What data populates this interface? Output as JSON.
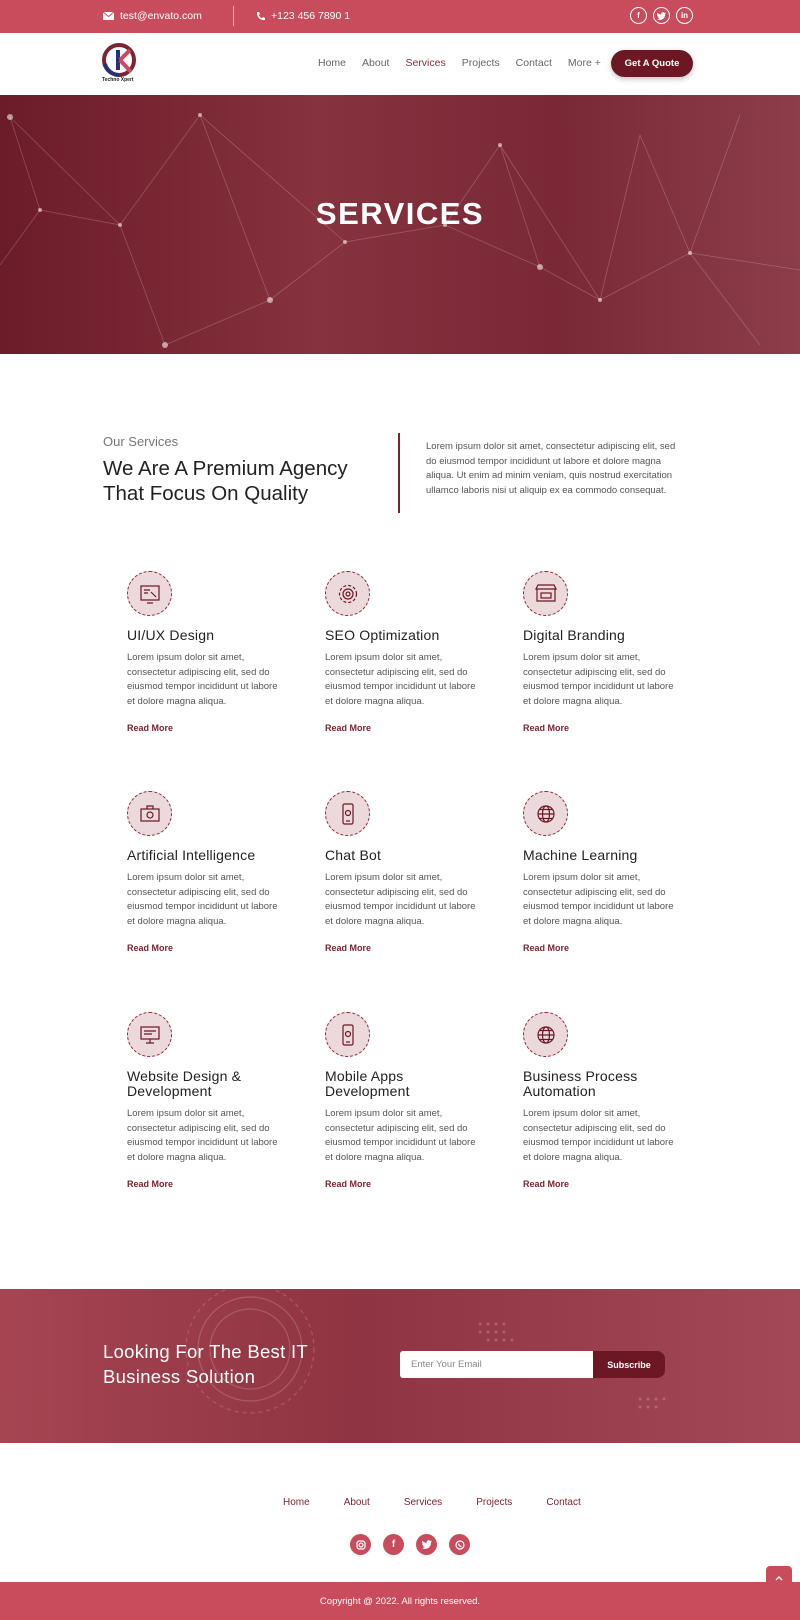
{
  "topbar": {
    "email": "test@envato.com",
    "phone": "+123 456 7890 1",
    "socials": [
      "facebook-icon",
      "twitter-icon",
      "linkedin-icon"
    ]
  },
  "nav": {
    "logo_text": "Techno Xpert",
    "items": [
      "Home",
      "About",
      "Services",
      "Projects",
      "Contact",
      "More +"
    ],
    "active": "Services",
    "quote_button": "Get A Quote"
  },
  "hero": {
    "title": "SERVICES"
  },
  "intro": {
    "subtitle": "Our Services",
    "title": "We Are A Premium Agency That Focus On Quality",
    "text": "Lorem ipsum dolor sit amet, consectetur adipiscing elit, sed do eiusmod tempor incididunt ut labore et dolore magna aliqua. Ut enim ad minim veniam, quis nostrud exercitation ullamco laboris nisi ut aliquip ex ea commodo consequat."
  },
  "services": [
    {
      "title": "UI/UX Design",
      "text": "Lorem ipsum dolor sit amet, consectetur adipiscing elit, sed do eiusmod tempor incididunt ut labore et dolore magna aliqua.",
      "link": "Read More",
      "icon": "design-icon"
    },
    {
      "title": "SEO Optimization",
      "text": "Lorem ipsum dolor sit amet, consectetur adipiscing elit, sed do eiusmod tempor incididunt ut labore et dolore magna aliqua.",
      "link": "Read More",
      "icon": "gear-icon"
    },
    {
      "title": "Digital Branding",
      "text": "Lorem ipsum dolor sit amet, consectetur adipiscing elit, sed do eiusmod tempor incididunt ut labore et dolore magna aliqua.",
      "link": "Read More",
      "icon": "store-icon"
    },
    {
      "title": "Artificial Intelligence",
      "text": "Lorem ipsum dolor sit amet, consectetur adipiscing elit, sed do eiusmod tempor incididunt ut labore et dolore magna aliqua.",
      "link": "Read More",
      "icon": "briefcase-icon"
    },
    {
      "title": "Chat Bot",
      "text": "Lorem ipsum dolor sit amet, consectetur adipiscing elit, sed do eiusmod tempor incididunt ut labore et dolore magna aliqua.",
      "link": "Read More",
      "icon": "mobile-icon"
    },
    {
      "title": "Machine Learning",
      "text": "Lorem ipsum dolor sit amet, consectetur adipiscing elit, sed do eiusmod tempor incididunt ut labore et dolore magna aliqua.",
      "link": "Read More",
      "icon": "globe-icon"
    },
    {
      "title": "Website Design & Development",
      "text": "Lorem ipsum dolor sit amet, consectetur adipiscing elit, sed do eiusmod tempor incididunt ut labore et dolore magna aliqua.",
      "link": "Read More",
      "icon": "monitor-icon"
    },
    {
      "title": "Mobile Apps Development",
      "text": "Lorem ipsum dolor sit amet, consectetur adipiscing elit, sed do eiusmod tempor incididunt ut labore et dolore magna aliqua.",
      "link": "Read More",
      "icon": "mobile-icon"
    },
    {
      "title": "Business Process Automation",
      "text": "Lorem ipsum dolor sit amet, consectetur adipiscing elit, sed do eiusmod tempor incididunt ut labore et dolore magna aliqua.",
      "link": "Read More",
      "icon": "globe-icon"
    }
  ],
  "cta": {
    "title": "Looking For The Best IT Business Solution",
    "placeholder": "Enter Your Email",
    "button": "Subscribe"
  },
  "footer": {
    "menu": [
      "Home",
      "About",
      "Services",
      "Projects",
      "Contact"
    ],
    "socials": [
      "instagram-icon",
      "facebook-icon",
      "twitter-icon",
      "whatsapp-icon"
    ],
    "copyright": "Copyright @ 2022. All rights reserved."
  },
  "colors": {
    "primary": "#c84c5b",
    "dark": "#6c1724",
    "accent": "#7a2532"
  }
}
